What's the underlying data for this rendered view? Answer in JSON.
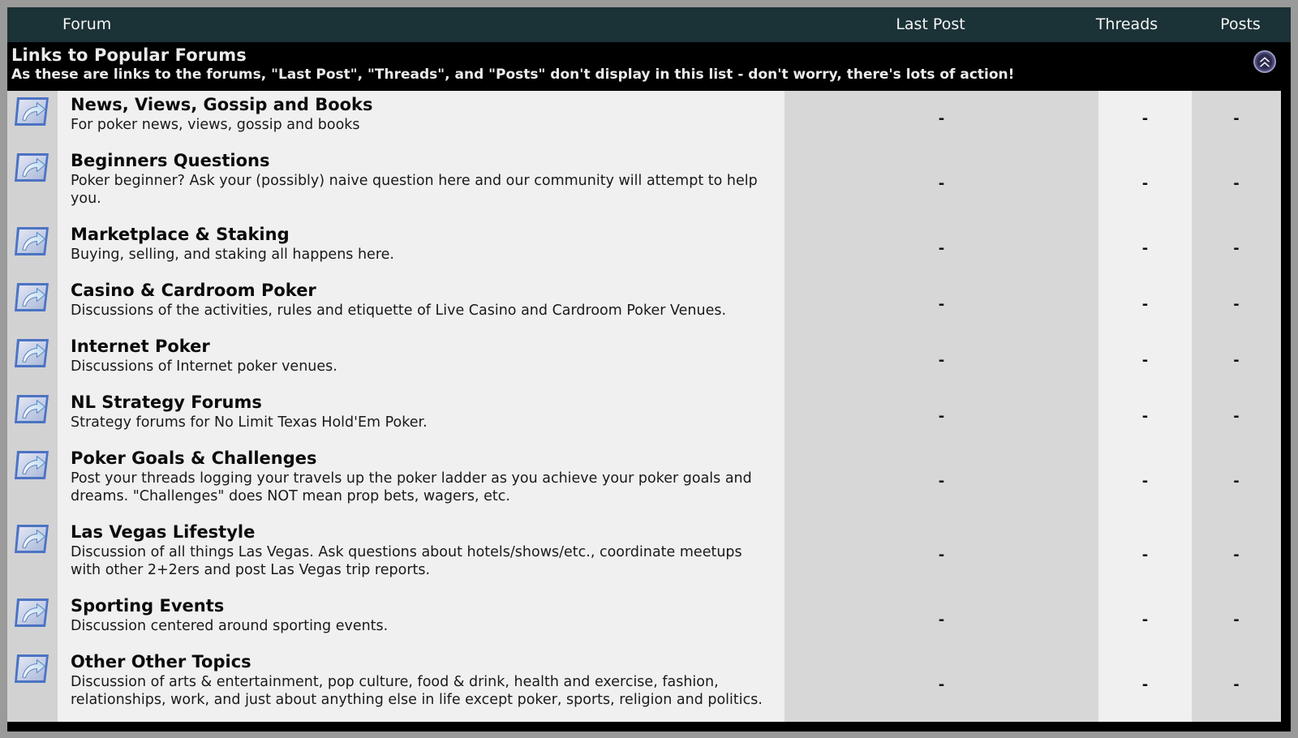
{
  "columns": {
    "forum": "Forum",
    "last_post": "Last Post",
    "threads": "Threads",
    "posts": "Posts"
  },
  "section": {
    "title": "Links to Popular Forums",
    "subtitle": "As these are links to the forums, \"Last Post\", \"Threads\", and \"Posts\" don't display in this list - don't worry, there's lots of action!",
    "collapse_icon": "double-chevron-up-icon"
  },
  "colors": {
    "header_bar": "#1b3237",
    "section_band": "#000000",
    "page_border": "#9a9a9a",
    "col_light": "#f0f0f0",
    "col_dark": "#d7d7d7",
    "icon_col": "#d2d2d2",
    "icon_border": "#4f78c8",
    "icon_fill": "#c6cfe6",
    "collapse_circle": "#5c5a8c"
  },
  "empty_value": "-",
  "rows": [
    {
      "icon": "forum-link-icon",
      "title": "News, Views, Gossip and Books",
      "desc": "For poker news, views, gossip and books",
      "last_post": "-",
      "threads": "-",
      "posts": "-"
    },
    {
      "icon": "forum-link-icon",
      "title": "Beginners Questions",
      "desc": "Poker beginner? Ask your (possibly) naive question here and our community will attempt to help you.",
      "last_post": "-",
      "threads": "-",
      "posts": "-"
    },
    {
      "icon": "forum-link-icon",
      "title": "Marketplace & Staking",
      "desc": "Buying, selling, and staking all happens here.",
      "last_post": "-",
      "threads": "-",
      "posts": "-"
    },
    {
      "icon": "forum-link-icon",
      "title": "Casino & Cardroom Poker",
      "desc": "Discussions of the activities, rules and etiquette of Live Casino and Cardroom Poker Venues.",
      "last_post": "-",
      "threads": "-",
      "posts": "-"
    },
    {
      "icon": "forum-link-icon",
      "title": "Internet Poker",
      "desc": "Discussions of Internet poker venues.",
      "last_post": "-",
      "threads": "-",
      "posts": "-"
    },
    {
      "icon": "forum-link-icon",
      "title": "NL Strategy Forums",
      "desc": "Strategy forums for No Limit Texas Hold'Em Poker.",
      "last_post": "-",
      "threads": "-",
      "posts": "-"
    },
    {
      "icon": "forum-link-icon",
      "title": "Poker Goals & Challenges",
      "desc": "Post your threads logging your travels up the poker ladder as you achieve your poker goals and dreams. \"Challenges\" does NOT mean prop bets, wagers, etc.",
      "last_post": "-",
      "threads": "-",
      "posts": "-"
    },
    {
      "icon": "forum-link-icon",
      "title": "Las Vegas Lifestyle",
      "desc": "Discussion of all things Las Vegas. Ask questions about hotels/shows/etc., coordinate meetups with other 2+2ers and post Las Vegas trip reports.",
      "last_post": "-",
      "threads": "-",
      "posts": "-"
    },
    {
      "icon": "forum-link-icon",
      "title": "Sporting Events",
      "desc": "Discussion centered around sporting events.",
      "last_post": "-",
      "threads": "-",
      "posts": "-"
    },
    {
      "icon": "forum-link-icon",
      "title": "Other Other Topics",
      "desc": "Discussion of arts & entertainment, pop culture, food & drink, health and exercise, fashion, relationships, work, and just about anything else in life except poker, sports, religion and politics.",
      "last_post": "-",
      "threads": "-",
      "posts": "-"
    }
  ]
}
